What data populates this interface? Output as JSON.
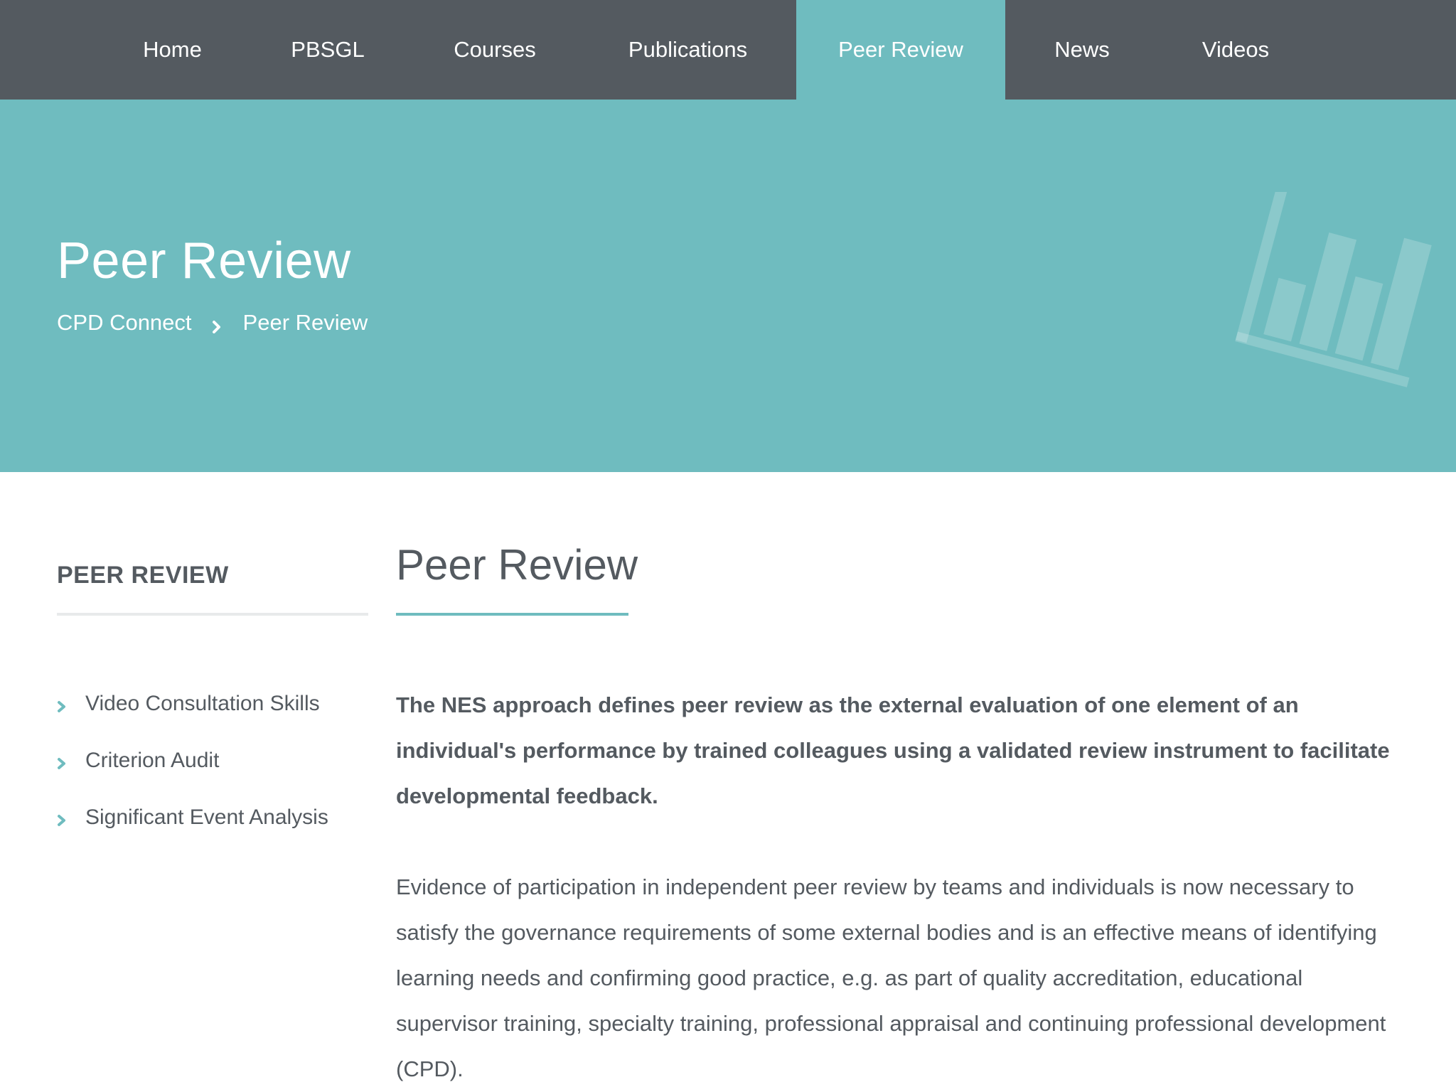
{
  "nav": {
    "items": [
      {
        "label": "Home"
      },
      {
        "label": "PBSGL"
      },
      {
        "label": "Courses"
      },
      {
        "label": "Publications"
      },
      {
        "label": "Peer Review",
        "active": true
      },
      {
        "label": "News"
      },
      {
        "label": "Videos"
      }
    ]
  },
  "hero": {
    "title": "Peer Review",
    "breadcrumb": {
      "home": "CPD Connect",
      "current": "Peer Review"
    },
    "icon": "bar-chart-icon"
  },
  "sidebar": {
    "title": "PEER REVIEW",
    "items": [
      {
        "label": "Video Consultation Skills",
        "icon": "chevron-right-icon"
      },
      {
        "label": "Criterion Audit",
        "icon": "chevron-right-icon"
      },
      {
        "label": "Significant Event Analysis",
        "icon": "chevron-right-icon"
      }
    ]
  },
  "main": {
    "title": "Peer Review",
    "lead": "The NES approach defines peer review as the external evaluation of one element of an individual's performance by trained colleagues using a validated review instrument to facilitate developmental feedback.",
    "body": "Evidence of participation in independent peer review by teams and individuals is now necessary to satisfy the governance requirements of some external bodies and is an effective means of identifying learning needs and confirming good practice, e.g. as part of quality accreditation, educational supervisor training, specialty training, professional appraisal and continuing professional development (CPD)."
  },
  "colors": {
    "nav_bg": "#545a60",
    "accent": "#6fbcbf",
    "text": "#545a60",
    "rule": "#e8eaeb"
  }
}
